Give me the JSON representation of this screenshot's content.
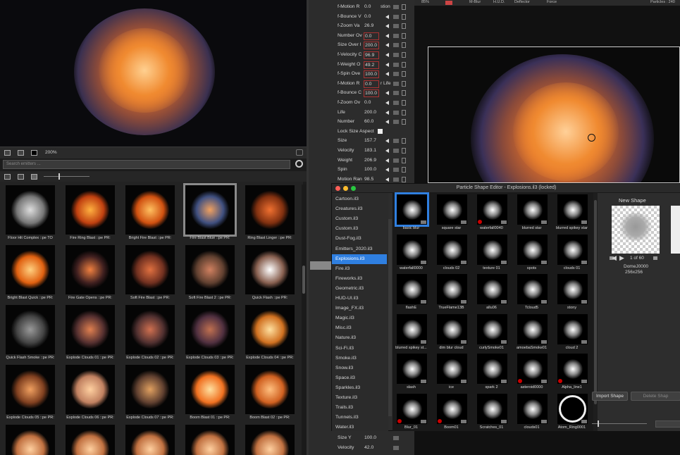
{
  "left_toolbar": {
    "zoom": "200%"
  },
  "search": {
    "placeholder": "Search emitters ..."
  },
  "emitters": [
    {
      "label": "Floor Hit Complex ::pe TO"
    },
    {
      "label": "Fire Ring Blast ::pe PR:"
    },
    {
      "label": "Bright Fire Blast ::pe PR:"
    },
    {
      "label": "Fire Blast Blue ::pe PR:"
    },
    {
      "label": "Ring Blast Linger ::pe PR:"
    },
    {
      "label": "Bright Blast Quick ::pe PR:"
    },
    {
      "label": "Fire Gate Opens ::pe PR:"
    },
    {
      "label": "Soft Fire Blast ::pe PR:"
    },
    {
      "label": "Soft Fire Blast 2 ::pe PR:"
    },
    {
      "label": "Quick Flash ::pe PR:"
    },
    {
      "label": "Quick Flash Smoke ::pe PR:"
    },
    {
      "label": "Explode Clouds 01 ::pe PR:"
    },
    {
      "label": "Explode Clouds 02 ::pe PR:"
    },
    {
      "label": "Explode Clouds 03 ::pe PR:"
    },
    {
      "label": "Explode Clouds 04 ::pe PR:"
    },
    {
      "label": "Explode Clouds 05 ::pe PR:"
    },
    {
      "label": "Explode Clouds 06 ::pe PR:"
    },
    {
      "label": "Explode Clouds 07 ::pe PR:"
    },
    {
      "label": "Boom Blast 01 ::pe PR:"
    },
    {
      "label": "Boom Blast 02 ::pe PR:"
    }
  ],
  "properties": [
    {
      "label": "f-Motion R",
      "extra": "stion",
      "value": "0.0"
    },
    {
      "label": "f-Bounce V",
      "value": "0.0"
    },
    {
      "label": "f-Zoom Va",
      "value": "26.9"
    },
    {
      "label": "Number Ov",
      "value": "0.0"
    },
    {
      "label": "Size Over l",
      "value": "200.0"
    },
    {
      "label": "f-Velocity C",
      "value": "96.9"
    },
    {
      "label": "f-Weight O",
      "value": "49.2"
    },
    {
      "label": "f-Spin Ove",
      "value": "100.0"
    },
    {
      "label": "f-Motion R",
      "extra": "r Life",
      "value": "0.0"
    },
    {
      "label": "f-Bounce C",
      "value": "100.0"
    },
    {
      "label": "f-Zoom Ov",
      "value": "0.0"
    },
    {
      "label": "Life",
      "value": "200.0"
    },
    {
      "label": "Number",
      "value": "60.0"
    },
    {
      "label": "Lock Size Aspect"
    },
    {
      "label": "Size",
      "value": "157.7"
    },
    {
      "label": "Velocity",
      "value": "183.1"
    },
    {
      "label": "Weight",
      "value": "206.9"
    },
    {
      "label": "Spin",
      "value": "100.0"
    },
    {
      "label": "Motion Ran",
      "value": "98.5"
    }
  ],
  "properties_bottom": [
    {
      "label": "Size Y",
      "value": "100.0"
    },
    {
      "label": "Velocity",
      "value": "42.0"
    }
  ],
  "viewport": {
    "zoom": "85%",
    "buttons": [
      "M-Blur",
      "H.U.D.",
      "Deflector",
      "Force"
    ],
    "particles": "Particles : 240"
  },
  "dialog": {
    "title": "Particle Shape Editor - Explosions.il3 (locked)",
    "libraries": [
      "Cartoon.il3",
      "Creatures.il3",
      "Custom.il3",
      "Custom.il3",
      "Dust-Fog.il3",
      "Emitters_2020.il3",
      "Explosions.il3",
      "Fire.il3",
      "Fireworks.il3",
      "Geometric.il3",
      "HUD-UI.il3",
      "Image_FX.il3",
      "Magic.il3",
      "Misc.il3",
      "Nature.il3",
      "Sci-Fi.il3",
      "Smoke.il3",
      "Snow.il3",
      "Space.il3",
      "Sparkles.il3",
      "Texture.il3",
      "Trails.il3",
      "Tunnels.il3",
      "Water.il3"
    ],
    "selected_library": "Explosions.il3",
    "shapes": [
      "basic blur",
      "square star",
      "waterfall0040",
      "blurred star",
      "blurred spikey star",
      "waterfall0000",
      "clouds 02",
      "texture 01",
      "spots",
      "clouds 01",
      "flashE",
      "TrueFlame13B",
      "allu06",
      "Tcloud5",
      "stony",
      "blurred spikey st...",
      "dim blur cloud",
      "curlySmoke01",
      "amoebaSmoke01",
      "cloud 2",
      "slash",
      "ice",
      "spark 2",
      "asteroid0000",
      "Alpha_line1",
      "Blur_01",
      "Boom01",
      "Scratches_01",
      "clouds01",
      "Atom_Ring0001"
    ],
    "new_shape_title": "New Shape",
    "counter": "1 of 60",
    "shape_name": "DomeJ0000",
    "shape_size": "256x256",
    "import_label": "Import Shape",
    "delete_label": "Delete Shap"
  }
}
